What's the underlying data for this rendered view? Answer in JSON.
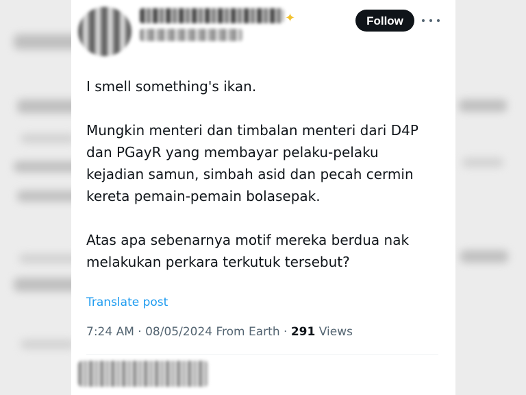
{
  "header": {
    "follow_label": "Follow",
    "more_icon": "more-horizontal-icon",
    "sparkle_icon": "sparkle-emoji"
  },
  "tweet": {
    "paragraphs": [
      [
        "I smell something's ikan."
      ],
      [
        "Mungkin menteri dan timbalan menteri dari D4P",
        "dan PGayR yang membayar pelaku-pelaku",
        "kejadian samun, simbah asid dan pecah cermin",
        "kereta pemain-pemain bolasepak."
      ],
      [
        "Atas apa sebenarnya motif mereka berdua nak",
        "melakukan perkara terkutuk tersebut?"
      ]
    ],
    "translate_label": "Translate post",
    "time": "7:24 AM",
    "separator": "·",
    "date": "08/05/2024",
    "source": "From Earth",
    "views_count": "291",
    "views_label": "Views"
  },
  "colors": {
    "text": "#0f1419",
    "secondary": "#536471",
    "link": "#1d9bf0",
    "follow_bg": "#0f1419",
    "sparkle": "#f2c230"
  }
}
